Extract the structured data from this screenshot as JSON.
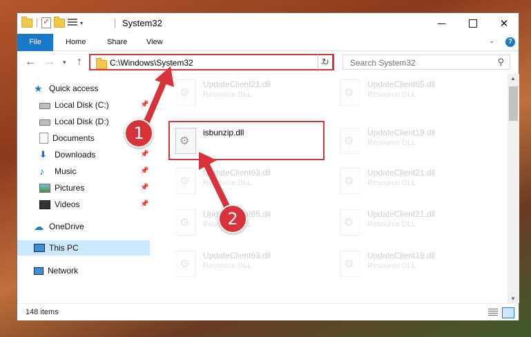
{
  "window": {
    "title": "System32",
    "controls": {
      "minimize": "—",
      "maximize": "☐",
      "close": "✕"
    }
  },
  "ribbon": {
    "tabs": [
      "File",
      "Home",
      "Share",
      "View"
    ],
    "help": "?"
  },
  "nav": {
    "address": "C:\\Windows\\System32",
    "search_placeholder": "Search System32"
  },
  "sidebar": {
    "items": [
      {
        "label": "Quick access",
        "icon": "star-icon"
      },
      {
        "label": "Local Disk (C:)",
        "icon": "drive-icon",
        "pinned": true
      },
      {
        "label": "Local Disk (D:)",
        "icon": "drive-icon",
        "pinned": true
      },
      {
        "label": "Documents",
        "icon": "documents-icon",
        "pinned": true
      },
      {
        "label": "Downloads",
        "icon": "download-icon",
        "pinned": true
      },
      {
        "label": "Music",
        "icon": "music-icon",
        "pinned": true
      },
      {
        "label": "Pictures",
        "icon": "pictures-icon",
        "pinned": true
      },
      {
        "label": "Videos",
        "icon": "videos-icon",
        "pinned": true
      },
      {
        "label": "OneDrive",
        "icon": "cloud-icon"
      },
      {
        "label": "This PC",
        "icon": "computer-icon",
        "selected": true
      },
      {
        "label": "Network",
        "icon": "network-icon"
      }
    ]
  },
  "files": {
    "left": [
      {
        "name": "UpdateClient21.dll",
        "type": "Resource DLL"
      },
      {
        "name": "isbunzip.dll",
        "type": ""
      },
      {
        "name": "UpdateClient63.dll",
        "type": "Resource DLL"
      },
      {
        "name": "UpdateClient65.dll",
        "type": "Resource DLL"
      },
      {
        "name": "UpdateClient63.dll",
        "type": "Resource DLL"
      }
    ],
    "right": [
      {
        "name": "UpdateClient65.dll",
        "type": "Resource DLL"
      },
      {
        "name": "UpdateClient19.dll",
        "type": "Resource DLL"
      },
      {
        "name": "UpdateClient21.dll",
        "type": "Resource DLL"
      },
      {
        "name": "UpdateClient21.dll",
        "type": "Resource DLL"
      },
      {
        "name": "UpdateClient19.dll",
        "type": "Resource DLL"
      }
    ]
  },
  "status": {
    "count": "148 items"
  },
  "annotations": {
    "marker1": "1",
    "marker2": "2",
    "color": "#d8323a"
  },
  "colors": {
    "accent": "#1979ca",
    "highlight": "#d0363e",
    "selected": "#cce8ff"
  }
}
